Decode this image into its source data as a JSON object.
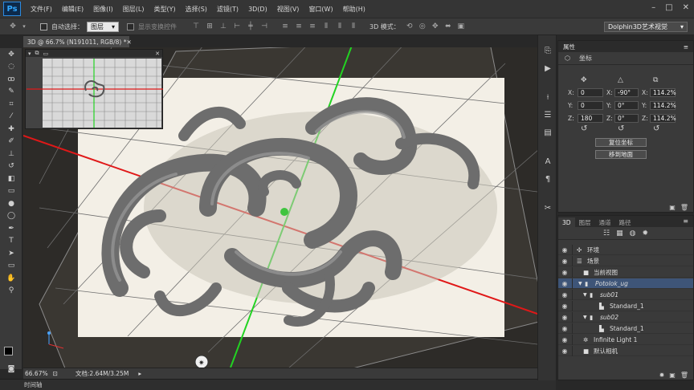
{
  "menubar": {
    "logo": "Ps",
    "items": [
      "文件(F)",
      "编辑(E)",
      "图像(I)",
      "图层(L)",
      "类型(Y)",
      "选择(S)",
      "滤镜(T)",
      "3D(D)",
      "视图(V)",
      "窗口(W)",
      "帮助(H)"
    ],
    "window_controls": [
      "–",
      "□",
      "✕"
    ]
  },
  "options": {
    "auto_select_label": "自动选择：",
    "auto_select_value": "图层",
    "show_transform_label": "显示变换控件",
    "mode_label": "3D 模式：",
    "workspace": "Dolphin3D艺术视觉"
  },
  "document": {
    "tab_title": "3D @ 66.7% (N191011, RGB/8) *",
    "zoom": "66.67%",
    "doc_info": "文档:2.64M/3.25M"
  },
  "timeline": {
    "label": "时间轴"
  },
  "properties": {
    "title": "属性",
    "section": "坐标",
    "rows": [
      {
        "axis": "X:",
        "pos": "0",
        "rot": "-90°",
        "scale": "114.2%"
      },
      {
        "axis": "Y:",
        "pos": "0",
        "rot": "0°",
        "scale": "114.2%"
      },
      {
        "axis": "Z:",
        "pos": "180",
        "rot": "0°",
        "scale": "114.2%"
      }
    ],
    "reset_button": "复位坐标",
    "move_ground_button": "移到地面"
  },
  "panel3d": {
    "tabs": [
      "3D",
      "图层",
      "通道",
      "路径"
    ],
    "items": [
      {
        "label": "环境",
        "indent": 0,
        "icon": "env-icon",
        "selected": false
      },
      {
        "label": "场景",
        "indent": 0,
        "icon": "scene-icon",
        "selected": false
      },
      {
        "label": "当前视图",
        "indent": 1,
        "icon": "camera-icon",
        "selected": false
      },
      {
        "label": "Potolok_ug",
        "indent": 1,
        "icon": "mesh-icon",
        "selected": true
      },
      {
        "label": "sub01",
        "indent": 2,
        "icon": "mesh-icon",
        "selected": false
      },
      {
        "label": "Standard_1",
        "indent": 3,
        "icon": "material-icon",
        "selected": false
      },
      {
        "label": "sub02",
        "indent": 2,
        "icon": "mesh-icon",
        "selected": false
      },
      {
        "label": "Standard_1",
        "indent": 3,
        "icon": "material-icon",
        "selected": false
      },
      {
        "label": "Infinite Light 1",
        "indent": 1,
        "icon": "light-icon",
        "selected": false
      },
      {
        "label": "默认相机",
        "indent": 1,
        "icon": "camera-icon",
        "selected": false
      }
    ]
  },
  "colors": {
    "accent_selection": "#3e5578",
    "x_axis": "#e01818",
    "y_axis": "#22d322",
    "panel_bg": "#3a3a3a"
  }
}
